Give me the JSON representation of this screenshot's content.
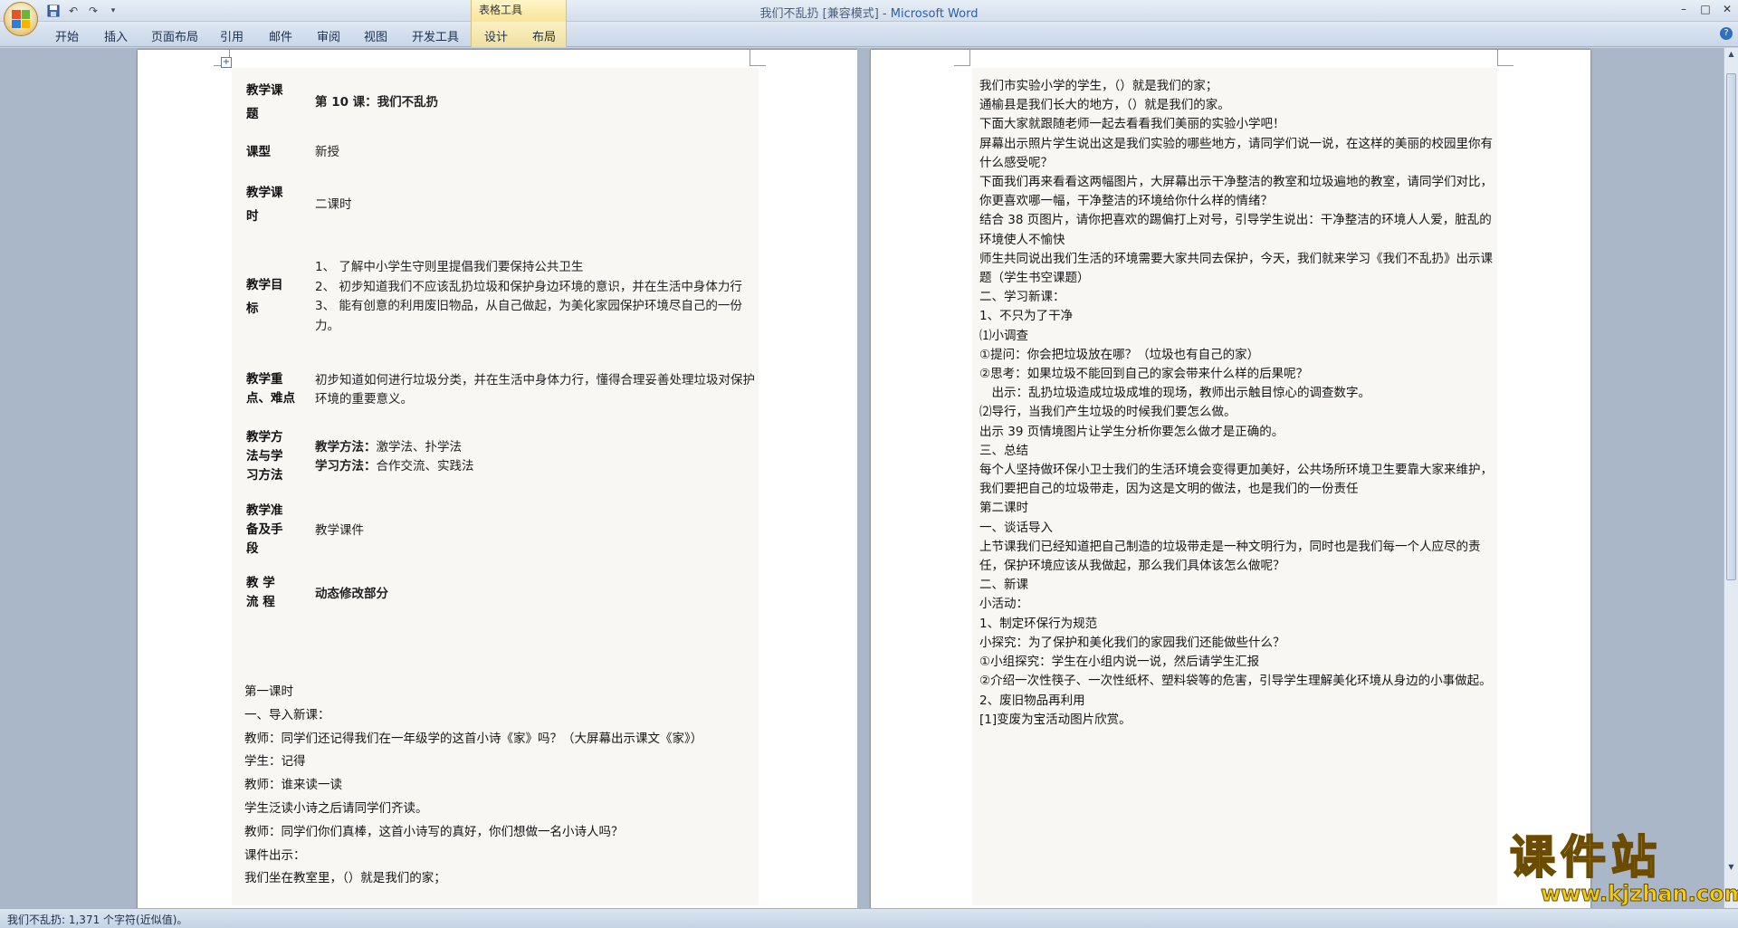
{
  "window": {
    "title": "我们不乱扔 [兼容模式] - ",
    "app_name": "Microsoft Word",
    "context_tab_group": "表格工具"
  },
  "ribbon": {
    "tabs": [
      "开始",
      "插入",
      "页面布局",
      "引用",
      "邮件",
      "审阅",
      "视图",
      "开发工具",
      "设计",
      "布局"
    ]
  },
  "lesson_table": [
    {
      "key": "教学课题",
      "value": "第 10 课：我们不乱扔",
      "bold": true
    },
    {
      "key": "课型",
      "value": "新授",
      "bold": false
    },
    {
      "key": "教学课时",
      "value": "二课时",
      "bold": false
    },
    {
      "key": "教学目标",
      "lines": [
        "1、 了解中小学生守则里提倡我们要保持公共卫生",
        "2、 初步知道我们不应该乱扔垃圾和保护身边环境的意识，并在生活中身体力行",
        "3、 能有创意的利用废旧物品，从自己做起，为美化家园保护环境尽自己的一份力。"
      ]
    },
    {
      "key": "教学重点、难点",
      "value": "初步知道如何进行垃圾分类，并在生活中身体力行，懂得合理妥善处理垃圾对保护环境的重要意义。",
      "bold": false
    },
    {
      "key": "教学方法与学习方法",
      "lines_labeled": [
        {
          "label": "教学方法：",
          "text": "激学法、扑学法"
        },
        {
          "label": "学习方法：",
          "text": "合作交流、实践法"
        }
      ]
    },
    {
      "key": "教学准备及手段",
      "value": "教学课件",
      "bold": false
    },
    {
      "key": "教 学 流 程",
      "value": "动态修改部分",
      "bold": true
    }
  ],
  "left_body": [
    "第一课时",
    "一、导入新课：",
    "教师：同学们还记得我们在一年级学的这首小诗《家》吗？（大屏幕出示课文《家》）",
    "学生：记得",
    "教师：谁来读一读",
    "学生泛读小诗之后请同学们齐读。",
    "教师：同学们你们真棒，这首小诗写的真好，你们想做一名小诗人吗？",
    "课件出示：",
    "我们坐在教室里，（）就是我们的家；"
  ],
  "right_body": [
    "我们市实验小学的学生，（）就是我们的家；",
    "通榆县是我们长大的地方，（）就是我们的家。",
    "下面大家就跟随老师一起去看看我们美丽的实验小学吧！",
    "屏幕出示照片学生说出这是我们实验的哪些地方，请同学们说一说，在这样的美丽的校园里你有什么感受呢？",
    "下面我们再来看看这两幅图片，大屏幕出示干净整洁的教室和垃圾遍地的教室，请同学们对比，你更喜欢哪一幅，干净整洁的环境给你什么样的情绪？",
    "结合 38 页图片，请你把喜欢的踢偏打上对号，引导学生说出：干净整洁的环境人人爱，脏乱的环境使人不愉快",
    "师生共同说出我们生活的环境需要大家共同去保护，今天，我们就来学习《我们不乱扔》出示课题（学生书空课题）",
    "二、学习新课：",
    "1、不只为了干净",
    "⑴小调查",
    "①提问：你会把垃圾放在哪？（垃圾也有自己的家）",
    "②思考：如果垃圾不能回到自己的家会带来什么样的后果呢？",
    "　出示：乱扔垃圾造成垃圾成堆的现场，教师出示触目惊心的调查数字。",
    "⑵导行，当我们产生垃圾的时候我们要怎么做。",
    "出示 39 页情境图片让学生分析你要怎么做才是正确的。",
    "三、总结",
    "每个人坚持做环保小卫士我们的生活环境会变得更加美好，公共场所环境卫生要靠大家来维护，我们要把自己的垃圾带走，因为这是文明的做法，也是我们的一份责任",
    "第二课时",
    "一、谈话导入",
    "上节课我们已经知道把自己制造的垃圾带走是一种文明行为，同时也是我们每一个人应尽的责任，保护环境应该从我做起，那么我们具体该怎么做呢？",
    "二、新课",
    "小活动：",
    "1、制定环保行为规范",
    "小探究：为了保护和美化我们的家园我们还能做些什么？",
    "①小组探究：学生在小组内说一说，然后请学生汇报",
    "②介绍一次性筷子、一次性纸杯、塑料袋等的危害，引导学生理解美化环境从身边的小事做起。",
    "2、废旧物品再利用",
    "[1]变废为宝活动图片欣赏。"
  ],
  "marks": {
    "para": "↵"
  },
  "status": {
    "text": "我们不乱扔: 1,371 个字符(近似值)。"
  },
  "watermark": {
    "cn": "课件站",
    "url": "www.kjzhan.com"
  },
  "icons": {
    "office": "office-button-icon",
    "save": "save-icon",
    "undo": "undo-icon",
    "redo": "redo-icon",
    "help": "help-icon"
  }
}
